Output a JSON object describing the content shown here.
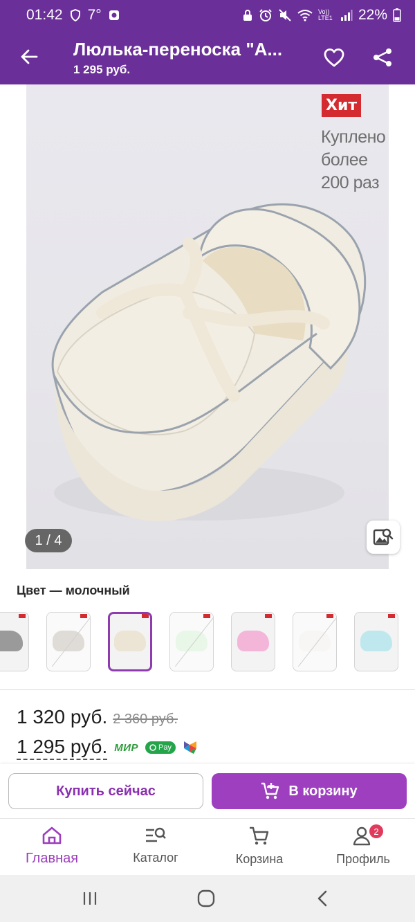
{
  "status_bar": {
    "time": "01:42",
    "temperature": "7°",
    "battery": "22%",
    "network": "Vo)) LTE1"
  },
  "app_bar": {
    "title": "Люлька-переноска \"А...",
    "subtitle": "1 295 руб."
  },
  "gallery": {
    "badge": "Хит",
    "bought_line1": "Куплено",
    "bought_line2": "более",
    "bought_line3": "200 раз",
    "counter": "1 / 4"
  },
  "color": {
    "label": "Цвет — молочный",
    "swatches": [
      {
        "color": "#9a9a9a",
        "available": true,
        "selected": false
      },
      {
        "color": "#b8b2a8",
        "available": false,
        "selected": false
      },
      {
        "color": "#ece4d4",
        "available": true,
        "selected": true
      },
      {
        "color": "#cdeec9",
        "available": false,
        "selected": false
      },
      {
        "color": "#f4b6d8",
        "available": true,
        "selected": false
      },
      {
        "color": "#efece6",
        "available": false,
        "selected": false
      },
      {
        "color": "#bfe8ee",
        "available": true,
        "selected": false
      }
    ]
  },
  "prices": {
    "current": "1 320 руб.",
    "old": "2 360 руб.",
    "card_price": "1 295 руб.",
    "mir_label": "МИР",
    "sbp_label": "Pay"
  },
  "actions": {
    "buy_now": "Купить сейчас",
    "to_cart": "В корзину"
  },
  "bottom_nav": {
    "home": "Главная",
    "catalog": "Каталог",
    "cart": "Корзина",
    "profile": "Профиль",
    "profile_badge": "2"
  },
  "colors": {
    "brand": "#6a2f98",
    "accent": "#9e3fc0",
    "hit_red": "#d32b2f"
  }
}
